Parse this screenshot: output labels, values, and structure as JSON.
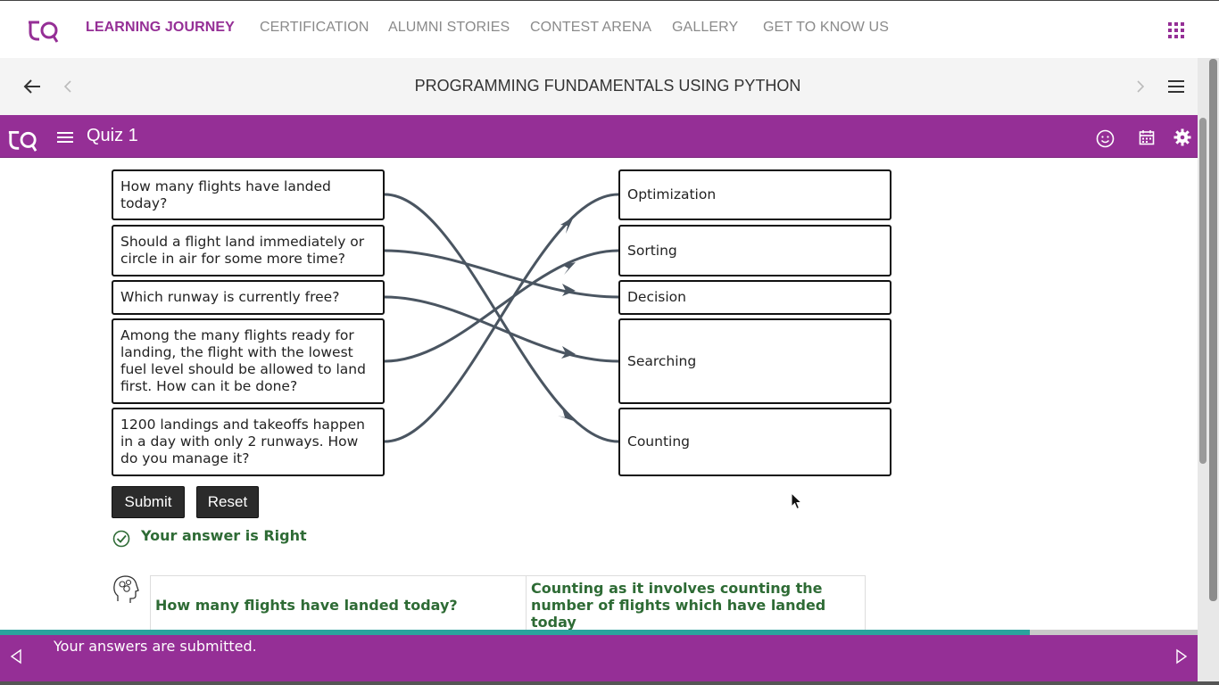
{
  "nav": {
    "items": [
      "LEARNING JOURNEY",
      "CERTIFICATION",
      "ALUMNI STORIES",
      "CONTEST ARENA",
      "GALLERY",
      "GET TO KNOW US"
    ],
    "active_index": 0,
    "accent_color": "#952f96"
  },
  "course": {
    "title": "PROGRAMMING FUNDAMENTALS USING PYTHON"
  },
  "quiz": {
    "title": "Quiz 1",
    "questions": [
      "How many flights have landed today?",
      "Should a flight land immediately or circle in air for some more time?",
      "Which runway is currently free?",
      "Among the many flights ready for landing, the flight with the lowest fuel level should be allowed to land first. How can it be done?",
      "1200 landings and takeoffs happen in a day with only 2 runways. How do you manage it?"
    ],
    "options": [
      "Optimization",
      "Sorting",
      "Decision",
      "Searching",
      "Counting"
    ],
    "submit_label": "Submit",
    "reset_label": "Reset",
    "result": "Your answer is Right",
    "explanation": {
      "question": "How many flights have landed today?",
      "answer": "Counting as it involves counting the number of flights which have landed today"
    }
  },
  "footer": {
    "message": "Your answers are submitted.",
    "progress": 0.86
  },
  "icons": {
    "nav_right": "apps-grid-icon",
    "quiz_header": [
      "smile-icon",
      "calendar-icon",
      "gear-icon"
    ]
  }
}
